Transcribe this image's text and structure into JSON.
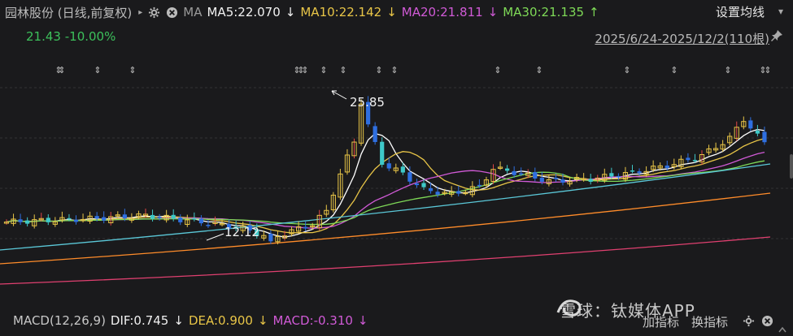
{
  "header": {
    "title": "园林股份 (日线,前复权)",
    "ma_label": "MA",
    "ma5": "MA5:22.070",
    "ma5_arrow": "↓",
    "ma10": "MA10:22.142",
    "ma10_arrow": "↓",
    "ma20": "MA20:21.811",
    "ma20_arrow": "↓",
    "ma30": "MA30:21.135",
    "ma30_arrow": "↑",
    "settings": "设置均线"
  },
  "quote": {
    "price": "21.43",
    "change": "-10.00%"
  },
  "date_range": "2025/6/24-2025/12/2(110根)",
  "annotations": {
    "high": "25.85",
    "low": "12.12"
  },
  "macd": {
    "title": "MACD(12,26,9)",
    "dif": "DIF:0.745",
    "dif_arrow": "↓",
    "dea": "DEA:0.900",
    "dea_arrow": "↓",
    "macd": "MACD:-0.310",
    "macd_arrow": "↓"
  },
  "buttons": {
    "add_indicator": "加指标",
    "switch_indicator": "换指标"
  },
  "watermark": "雪球：钛媒体APP",
  "colors": {
    "up": "#e8c547",
    "down": "#2f6fe0",
    "ma5": "#ffffff",
    "ma10": "#e8c547",
    "ma20": "#d05ad6",
    "ma30": "#7ed957",
    "ma60": "#5bc8d8",
    "ma120": "#ff8c2a",
    "ma250": "#e04070"
  }
}
